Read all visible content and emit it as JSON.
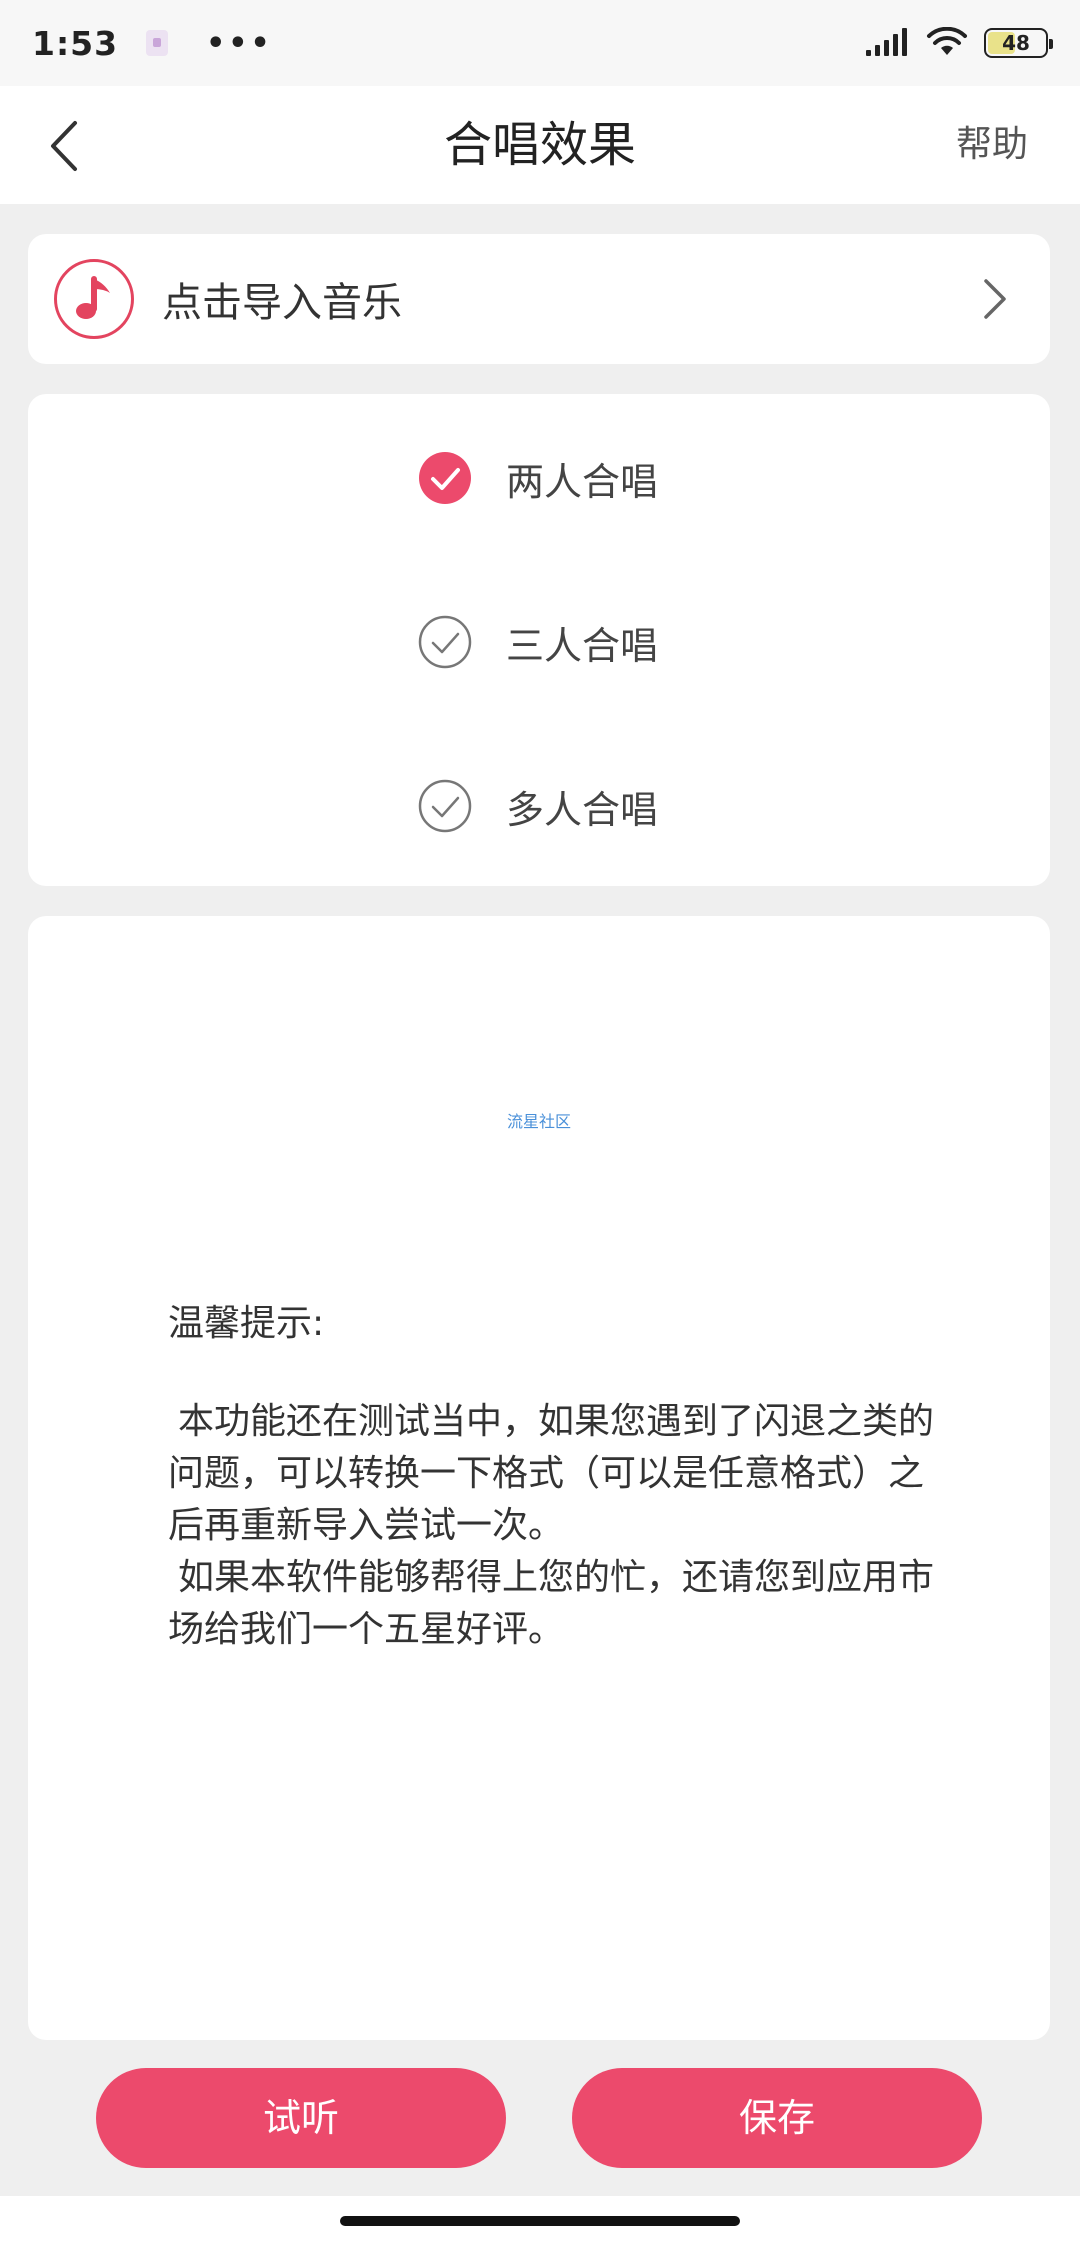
{
  "status_bar": {
    "time": "1:53",
    "more": "•••",
    "battery": "48",
    "battery_level": 0.48
  },
  "header": {
    "title": "合唱效果",
    "help_label": "帮助"
  },
  "import": {
    "label": "点击导入音乐"
  },
  "options": [
    {
      "label": "两人合唱",
      "selected": true
    },
    {
      "label": "三人合唱",
      "selected": false
    },
    {
      "label": "多人合唱",
      "selected": false
    }
  ],
  "info": {
    "watermark": "流星社区",
    "tip_title": "温馨提示:",
    "paragraphs": [
      "本功能还在测试当中，如果您遇到了闪退之类的问题，可以转换一下格式（可以是任意格式）之后再重新导入尝试一次。",
      "如果本软件能够帮得上您的忙，还请您到应用市场给我们一个五星好评。"
    ]
  },
  "buttons": {
    "preview_label": "试听",
    "save_label": "保存"
  },
  "colors": {
    "accent": "#ec4a6c",
    "background": "#efefef"
  }
}
